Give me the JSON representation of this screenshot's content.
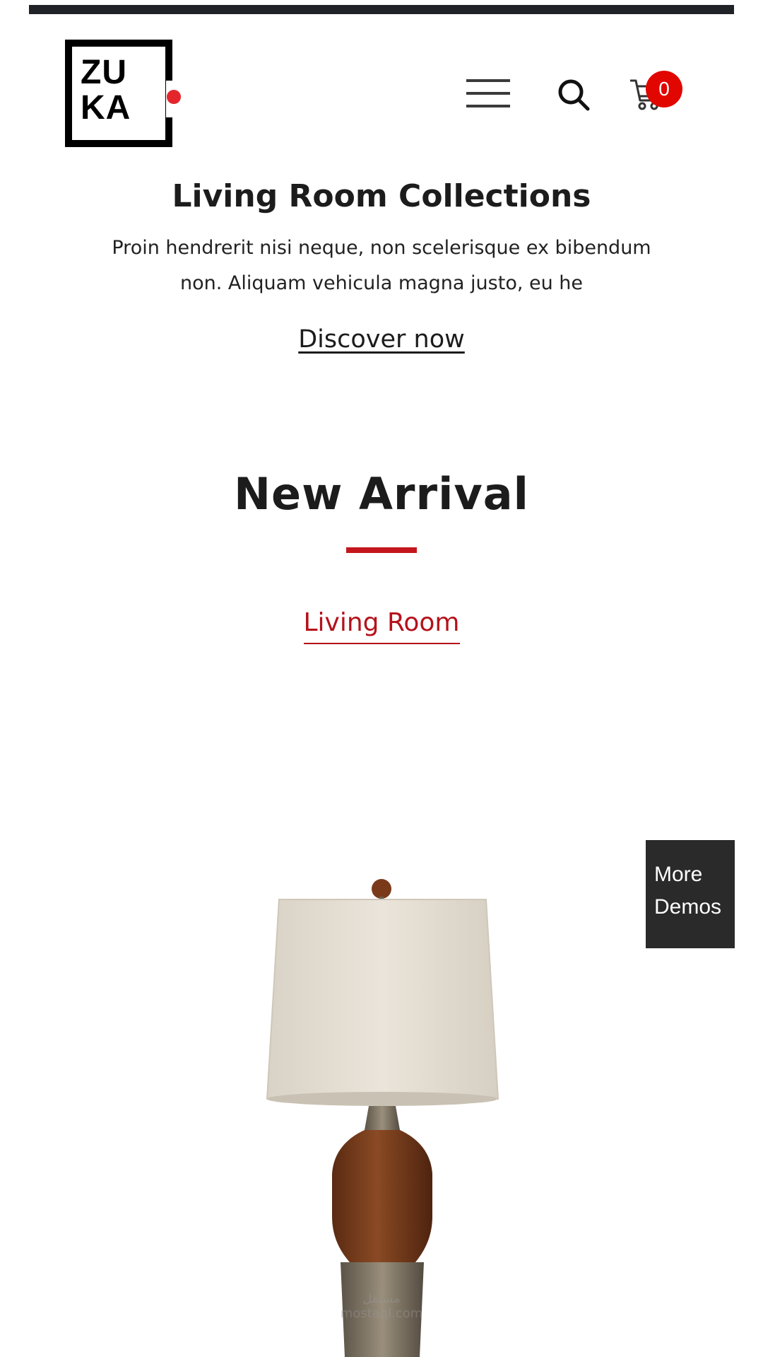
{
  "brand": {
    "logo_line1": "ZU",
    "logo_line2": "KA",
    "accent_color": "#e4262c"
  },
  "header": {
    "menu_icon": "hamburger-menu-icon",
    "search_icon": "search-icon",
    "cart_icon": "cart-icon",
    "cart_count": "0"
  },
  "hero": {
    "title": "Living Room Collections",
    "description": "Proin hendrerit nisi neque, non scelerisque ex bibendum non. Aliquam vehicula magna justo, eu he",
    "cta_label": "Discover now"
  },
  "new_arrival": {
    "title": "New Arrival",
    "rule_color": "#c4161c",
    "active_tab": "Living Room"
  },
  "product": {
    "image": "table-lamp"
  },
  "floating": {
    "more_demos_label": "More Demos"
  },
  "watermark": {
    "text_ar": "مستقل",
    "text_url": "mostaql.com"
  }
}
